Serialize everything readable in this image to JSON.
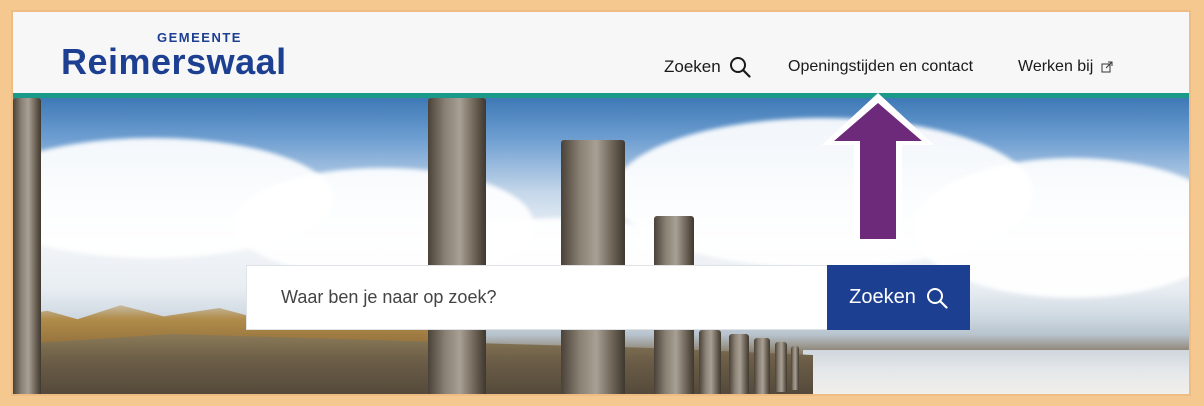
{
  "logo": {
    "small": "GEMEENTE",
    "big": "Reimerswaal"
  },
  "nav": {
    "search_label": "Zoeken",
    "contact_label": "Openingstijden en contact",
    "werken_label": "Werken bij"
  },
  "search": {
    "placeholder": "Waar ben je naar op zoek?",
    "button_label": "Zoeken"
  },
  "icons": {
    "nav_search": "search-icon",
    "werken_external": "external-link-icon",
    "search_button": "search-icon",
    "annotation": "arrow-up-icon"
  },
  "colors": {
    "brand_blue": "#1c3f92",
    "header_accent": "#1b9a8a",
    "annotation_arrow": "#6e2a7a",
    "frame": "#f5c88f"
  }
}
